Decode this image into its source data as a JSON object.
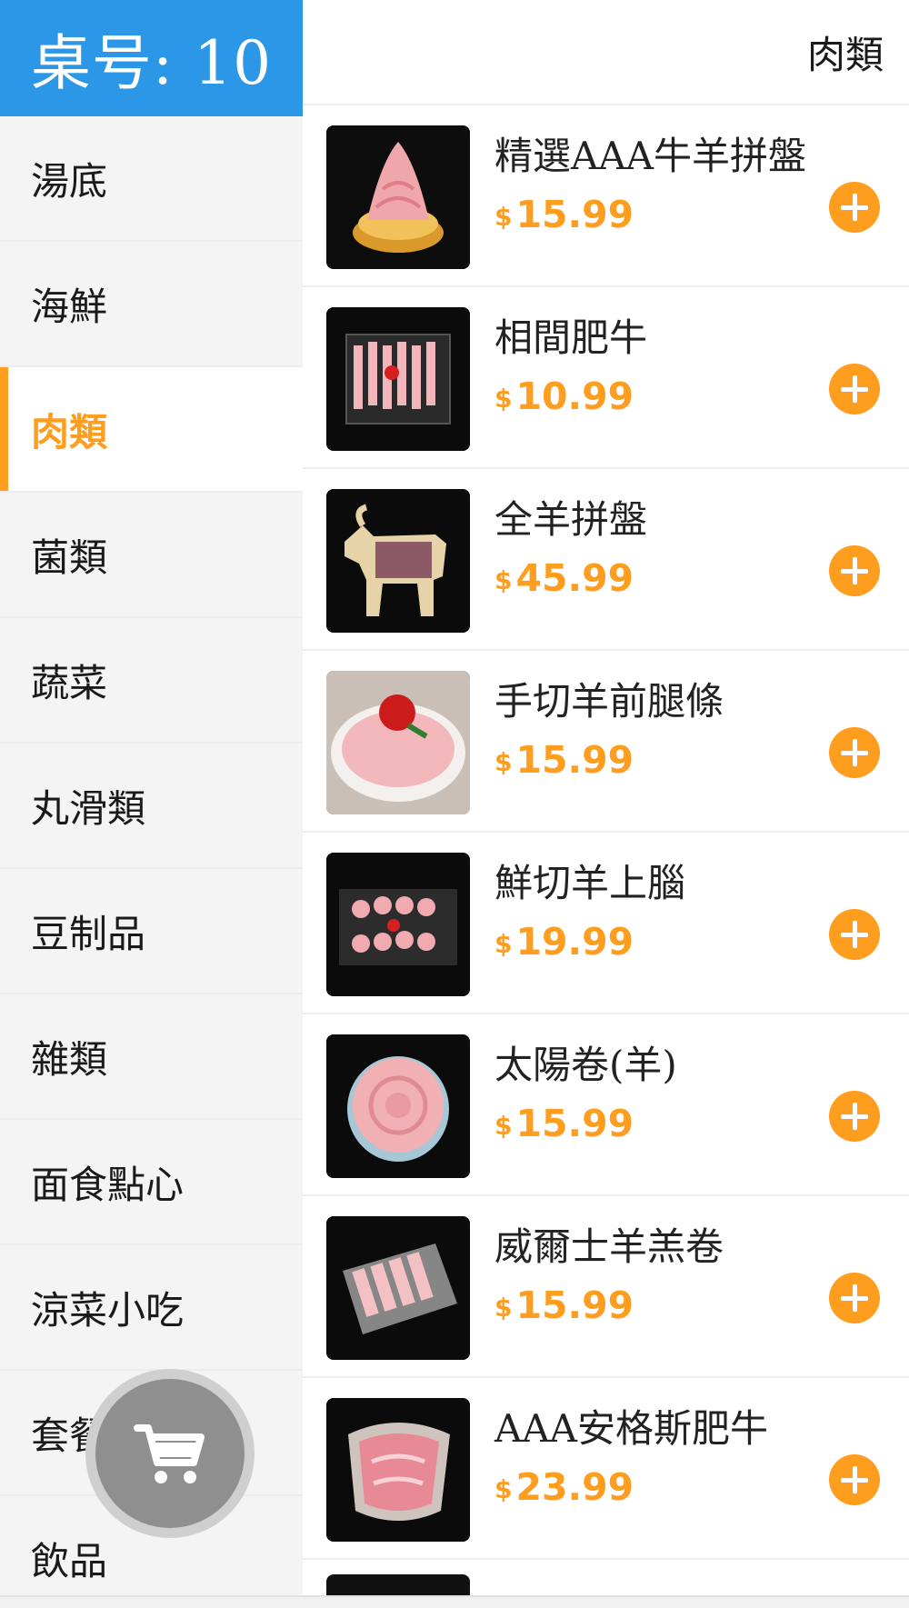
{
  "sidebar": {
    "table_label": "桌号: 10",
    "categories": [
      {
        "label": "湯底",
        "active": false
      },
      {
        "label": "海鮮",
        "active": false
      },
      {
        "label": "肉類",
        "active": true
      },
      {
        "label": "菌類",
        "active": false
      },
      {
        "label": "蔬菜",
        "active": false
      },
      {
        "label": "丸滑類",
        "active": false
      },
      {
        "label": "豆制品",
        "active": false
      },
      {
        "label": "雜類",
        "active": false
      },
      {
        "label": "面食點心",
        "active": false
      },
      {
        "label": "涼菜小吃",
        "active": false
      },
      {
        "label": "套餐",
        "active": false
      },
      {
        "label": "飲品",
        "active": false
      }
    ]
  },
  "main": {
    "section_title": "肉類",
    "currency_symbol": "$",
    "products": [
      {
        "name": "精選AAA牛羊拼盤",
        "price": "15.99",
        "image": "meat-mountain-plate"
      },
      {
        "name": "相間肥牛",
        "price": "10.99",
        "image": "beef-rolls-tray"
      },
      {
        "name": "全羊拼盤",
        "price": "45.99",
        "image": "whole-lamb-board"
      },
      {
        "name": "手切羊前腿條",
        "price": "15.99",
        "image": "lamb-rose-platter"
      },
      {
        "name": "鮮切羊上腦",
        "price": "19.99",
        "image": "lamb-slices-glass-tray"
      },
      {
        "name": "太陽卷(羊)",
        "price": "15.99",
        "image": "sun-roll-plate"
      },
      {
        "name": "威爾士羊羔卷",
        "price": "15.99",
        "image": "lamb-rolls-box"
      },
      {
        "name": "AAA安格斯肥牛",
        "price": "23.99",
        "image": "angus-beef-bowl"
      }
    ]
  },
  "cart": {
    "icon": "cart-icon"
  },
  "colors": {
    "accent": "#ff9d1e",
    "header_blue": "#2b97e6",
    "sidebar_bg": "#f4f4f4"
  }
}
